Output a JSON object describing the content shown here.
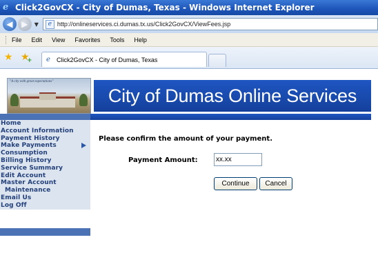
{
  "window": {
    "title": "Click2GovCX - City of Dumas, Texas - Windows Internet Explorer"
  },
  "address_bar": {
    "url": "http://onlineservices.ci.dumas.tx.us/Click2GovCX/ViewFees.jsp"
  },
  "menu": {
    "items": [
      "File",
      "Edit",
      "View",
      "Favorites",
      "Tools",
      "Help"
    ]
  },
  "tab": {
    "label": "Click2GovCX - City of Dumas, Texas"
  },
  "header": {
    "logo_caption": "\"A city with great expectations\"",
    "banner_title": "City of Dumas Online Services"
  },
  "sidebar": {
    "items": [
      {
        "label": "Home"
      },
      {
        "label": "Account Information"
      },
      {
        "label": "Payment History"
      },
      {
        "label": "Make Payments"
      },
      {
        "label": "Consumption"
      },
      {
        "label": "Billing History"
      },
      {
        "label": "Service Summary"
      },
      {
        "label": "Edit Account"
      },
      {
        "label": "Master Account"
      },
      {
        "label": "Maintenance"
      },
      {
        "label": "Email Us"
      },
      {
        "label": "Log Off"
      }
    ],
    "active_item": "Make Payments"
  },
  "main": {
    "confirm_text": "Please confirm the amount of your payment.",
    "amount_label": "Payment Amount:",
    "amount_value": "xx.xx",
    "continue_label": "Continue",
    "cancel_label": "Cancel"
  },
  "colors": {
    "banner_blue": "#1f56c2",
    "sidebar_bg": "#dbe4ef",
    "sidebar_text": "#23407a"
  },
  "icons": [
    "ie-logo-icon",
    "back-arrow-icon",
    "forward-arrow-icon",
    "favorites-star-icon",
    "add-favorite-icon",
    "page-icon"
  ]
}
